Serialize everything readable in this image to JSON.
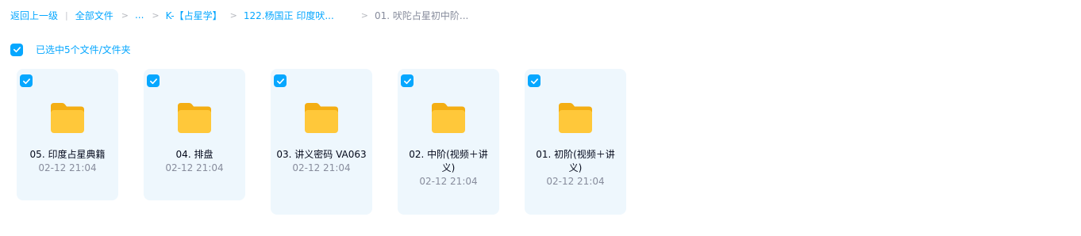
{
  "breadcrumb": {
    "back": "返回上一级",
    "all_files": "全部文件",
    "ellipsis": "...",
    "level1": "K-【占星学】",
    "level2": "122.杨国正 印度吠...",
    "current": "01. 吠陀占星初中阶..."
  },
  "selection": {
    "text": "已选中5个文件/文件夹"
  },
  "files": [
    {
      "name": "05. 印度占星典籍",
      "date": "02-12 21:04"
    },
    {
      "name": "04. 排盘",
      "date": "02-12 21:04"
    },
    {
      "name": "03. 讲义密码 VA063",
      "date": "02-12 21:04"
    },
    {
      "name": "02. 中阶(视频＋讲义)",
      "date": "02-12 21:04"
    },
    {
      "name": "01. 初阶(视频＋讲义)",
      "date": "02-12 21:04"
    }
  ],
  "colors": {
    "accent": "#06a7ff",
    "card_bg": "#eef7fd",
    "folder": "#ffc83a",
    "muted": "#878c9c"
  }
}
